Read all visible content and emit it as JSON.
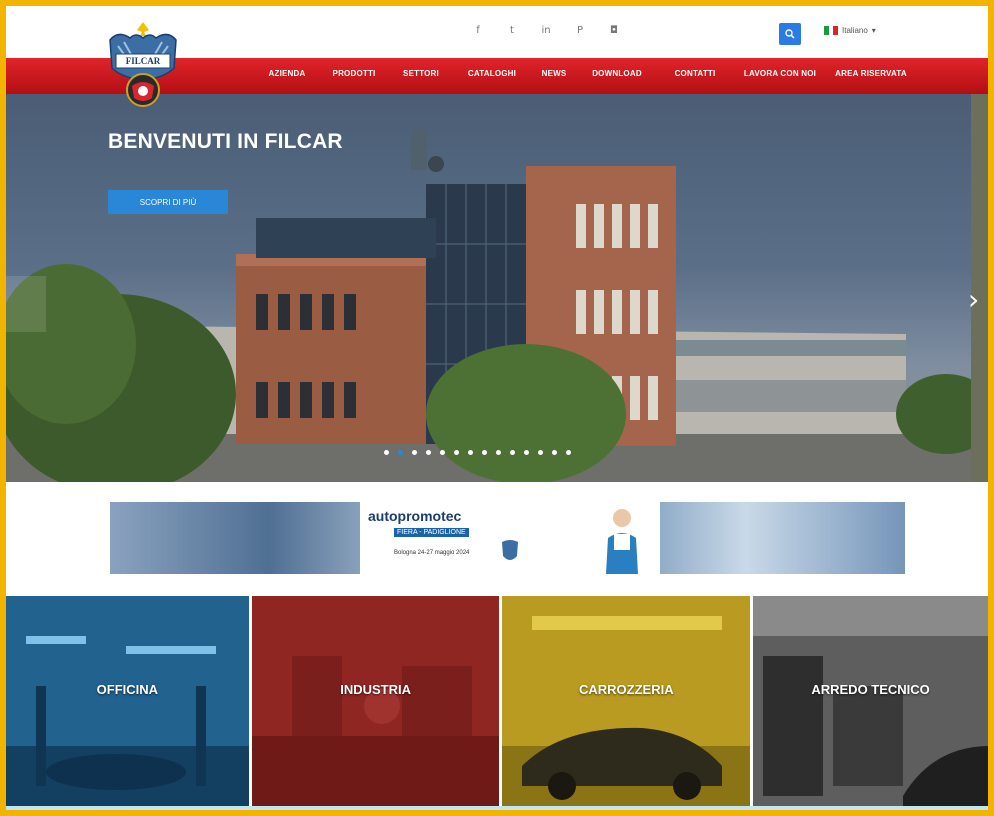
{
  "brand": {
    "logo_text": "FILCAR"
  },
  "header": {
    "social_icons": [
      "facebook-icon",
      "twitter-icon",
      "linkedin-icon",
      "pinterest-icon",
      "instagram-icon"
    ],
    "language": {
      "selected": "Italiano"
    },
    "search_icon": "search-icon"
  },
  "nav": {
    "items": [
      {
        "label": "AZIENDA"
      },
      {
        "label": "PRODOTTI"
      },
      {
        "label": "SETTORI"
      },
      {
        "label": "CATALOGHI"
      },
      {
        "label": "NEWS"
      },
      {
        "label": "DOWNLOAD"
      },
      {
        "label": "CONTATTI"
      },
      {
        "label": "LAVORA CON NOI"
      },
      {
        "label": "AREA RISERVATA"
      }
    ]
  },
  "hero": {
    "title": "BENVENUTI IN FILCAR",
    "button_label": "SCOPRI DI PIÙ",
    "slide_count": 14,
    "active_slide": 1
  },
  "banner": {
    "brand": "autopromotec",
    "sub": "FIERA - PADIGLIONE",
    "date": "Bologna 24-27 maggio 2024"
  },
  "categories": [
    {
      "label": "OFFICINA",
      "tint": "#1f5e8a"
    },
    {
      "label": "INDUSTRIA",
      "tint": "#8e2420"
    },
    {
      "label": "CARROZZERIA",
      "tint": "#b79a1e"
    },
    {
      "label": "ARREDO TECNICO",
      "tint": "#585858"
    }
  ],
  "colors": {
    "accent_red": "#d11b21",
    "accent_blue": "#2a86d6",
    "frame": "#f3b400"
  }
}
